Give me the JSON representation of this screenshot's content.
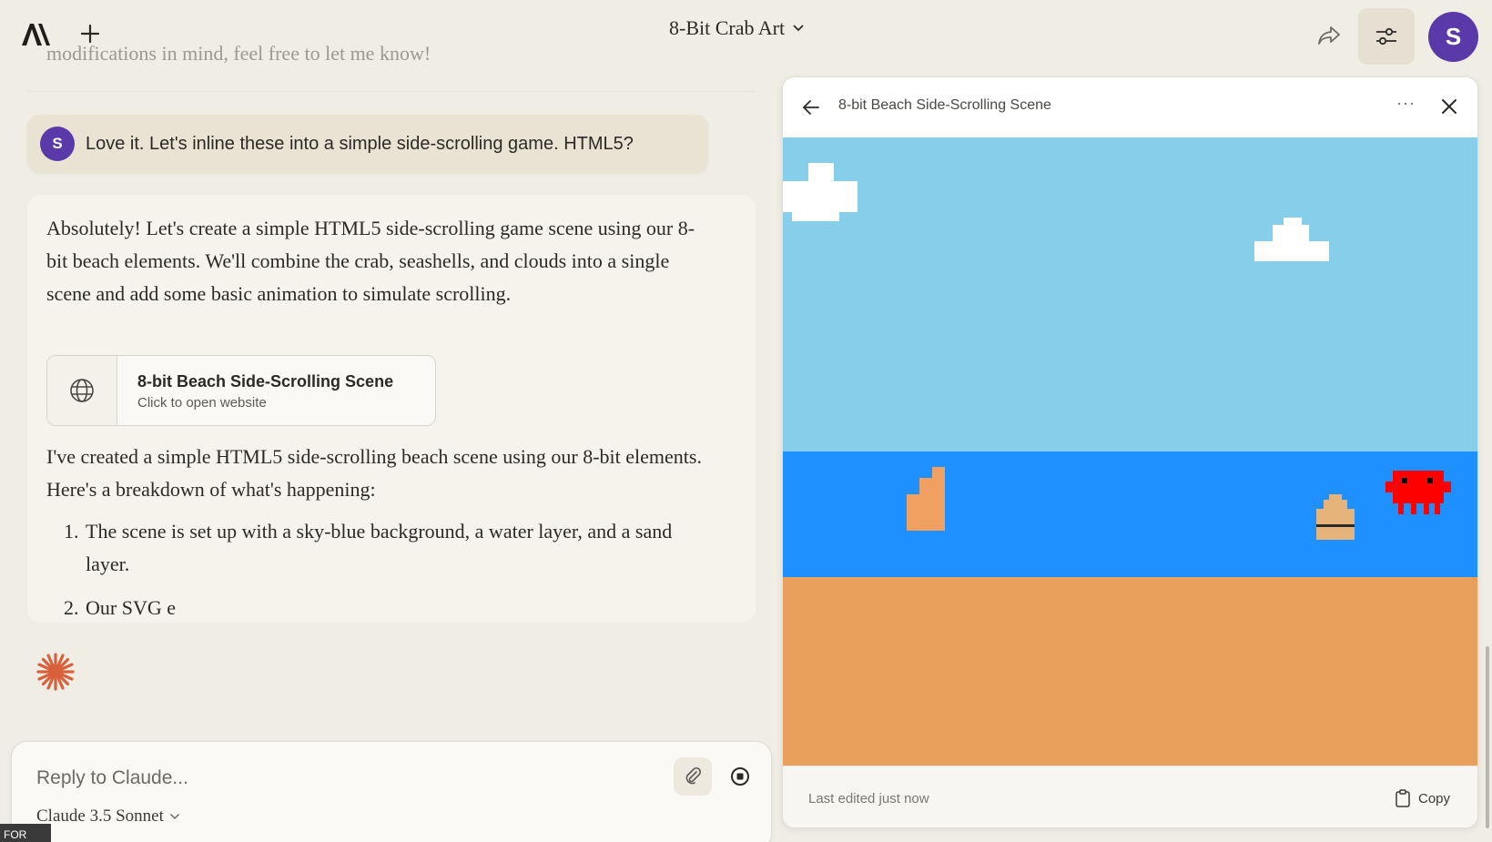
{
  "header": {
    "chat_title": "8-Bit Crab Art",
    "avatar_initial": "S"
  },
  "chat": {
    "faded_previous_text": "modifications in mind, feel free to let me know!",
    "user_message": {
      "avatar_initial": "S",
      "text": "Love it. Let's inline these into a simple side-scrolling game. HTML5?"
    },
    "assistant": {
      "paragraph1": "Absolutely! Let's create a simple HTML5 side-scrolling game scene using our 8-bit beach elements. We'll combine the crab, seashells, and clouds into a single scene and add some basic animation to simulate scrolling.",
      "artifact_card": {
        "title": "8-bit Beach Side-Scrolling Scene",
        "subtitle": "Click to open website"
      },
      "paragraph2": "I've created a simple HTML5 side-scrolling beach scene using our 8-bit elements. Here's a breakdown of what's happening:",
      "list": [
        {
          "num": "1.",
          "text": "The scene is set up with a sky-blue background, a water layer, and a sand layer."
        },
        {
          "num": "2.",
          "text": "Our SVG e"
        }
      ]
    }
  },
  "reply": {
    "placeholder": "Reply to Claude...",
    "model": "Claude 3.5 Sonnet"
  },
  "corner_tag": "FOR",
  "panel": {
    "title": "8-bit Beach Side-Scrolling Scene",
    "more_label": "···",
    "footer_status": "Last edited just now",
    "copy_label": "Copy"
  },
  "colors": {
    "sky": "#87ceeb",
    "water": "#1e90ff",
    "sand": "#e8a05c",
    "crab": "#ff0000",
    "avatar": "#5a3aa8",
    "spark": "#d9603b"
  }
}
